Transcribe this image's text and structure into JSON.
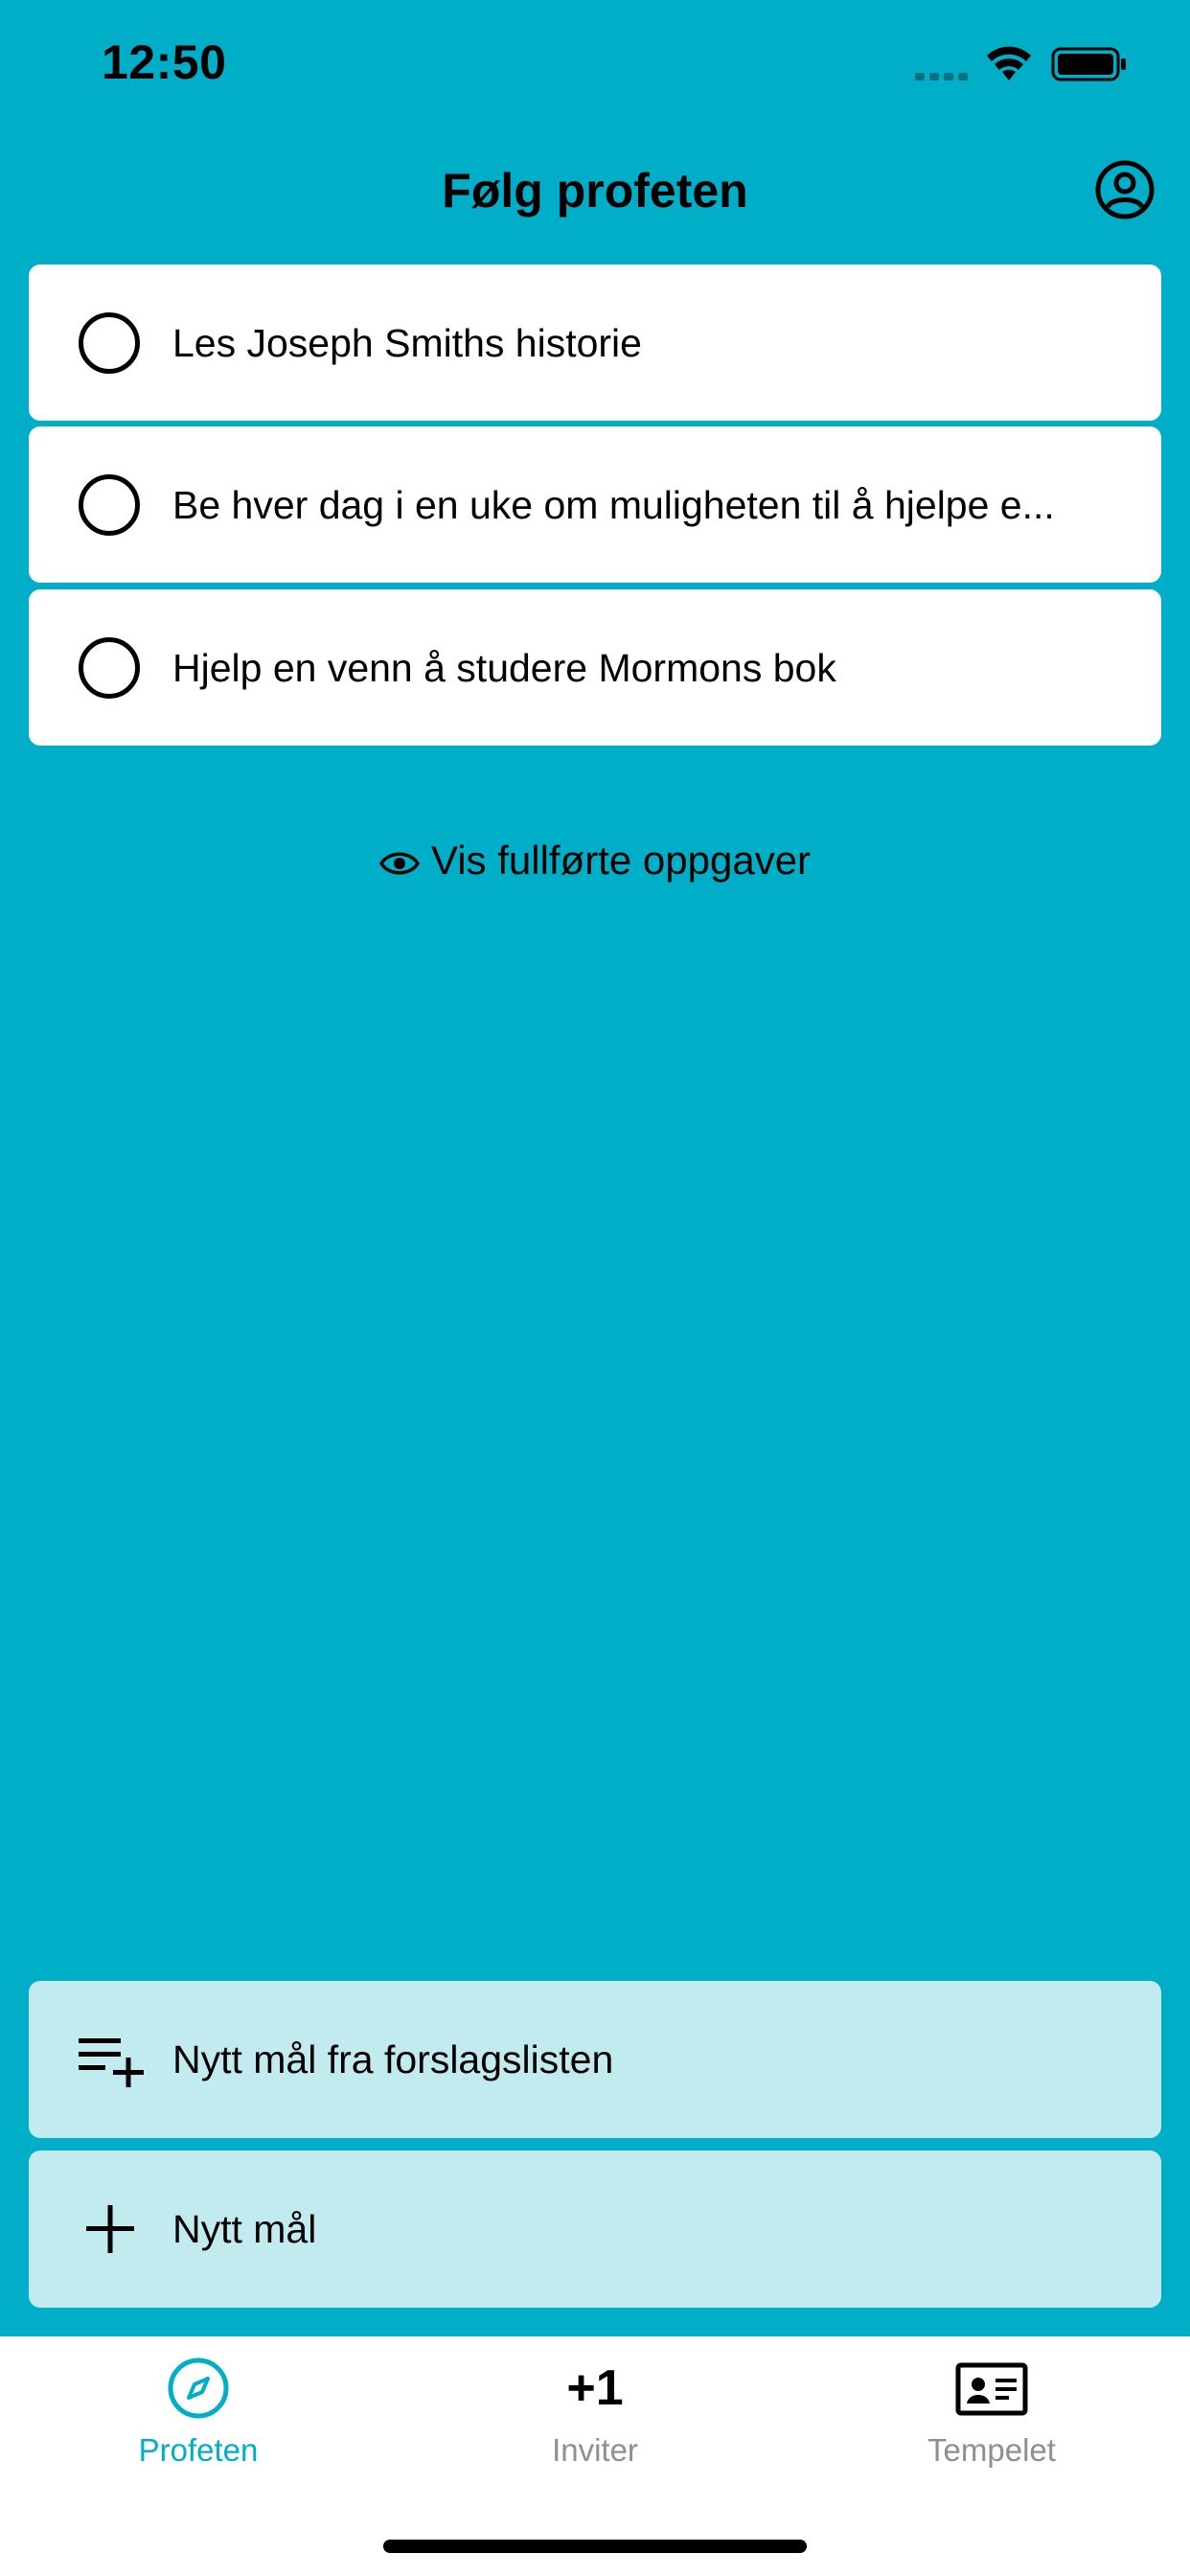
{
  "status_bar": {
    "time": "12:50"
  },
  "nav": {
    "title": "Følg profeten",
    "profile_icon": "person-circle-icon"
  },
  "tasks": [
    {
      "label": "Les Joseph Smiths historie",
      "completed": false
    },
    {
      "label": "Be hver dag i en uke om muligheten til å hjelpe e...",
      "completed": false
    },
    {
      "label": "Hjelp en venn å studere Mormons bok",
      "completed": false
    }
  ],
  "show_completed": {
    "label": "Vis fullførte oppgaver",
    "icon": "eye-icon"
  },
  "actions": [
    {
      "label": "Nytt mål fra forslagslisten",
      "icon": "playlist-add-icon"
    },
    {
      "label": "Nytt mål",
      "icon": "plus-icon"
    }
  ],
  "tab_bar": {
    "tabs": [
      {
        "label": "Profeten",
        "icon": "compass-icon",
        "active": true
      },
      {
        "label": "Inviter",
        "icon_text": "+1",
        "active": false
      },
      {
        "label": "Tempelet",
        "icon": "id-card-icon",
        "active": false
      }
    ]
  },
  "colors": {
    "background": "#00AFC7",
    "card": "#FFFFFF",
    "action_card": "#C2EBF0",
    "active_tab": "#00AFC7",
    "inactive_tab": "#8E8E93"
  }
}
